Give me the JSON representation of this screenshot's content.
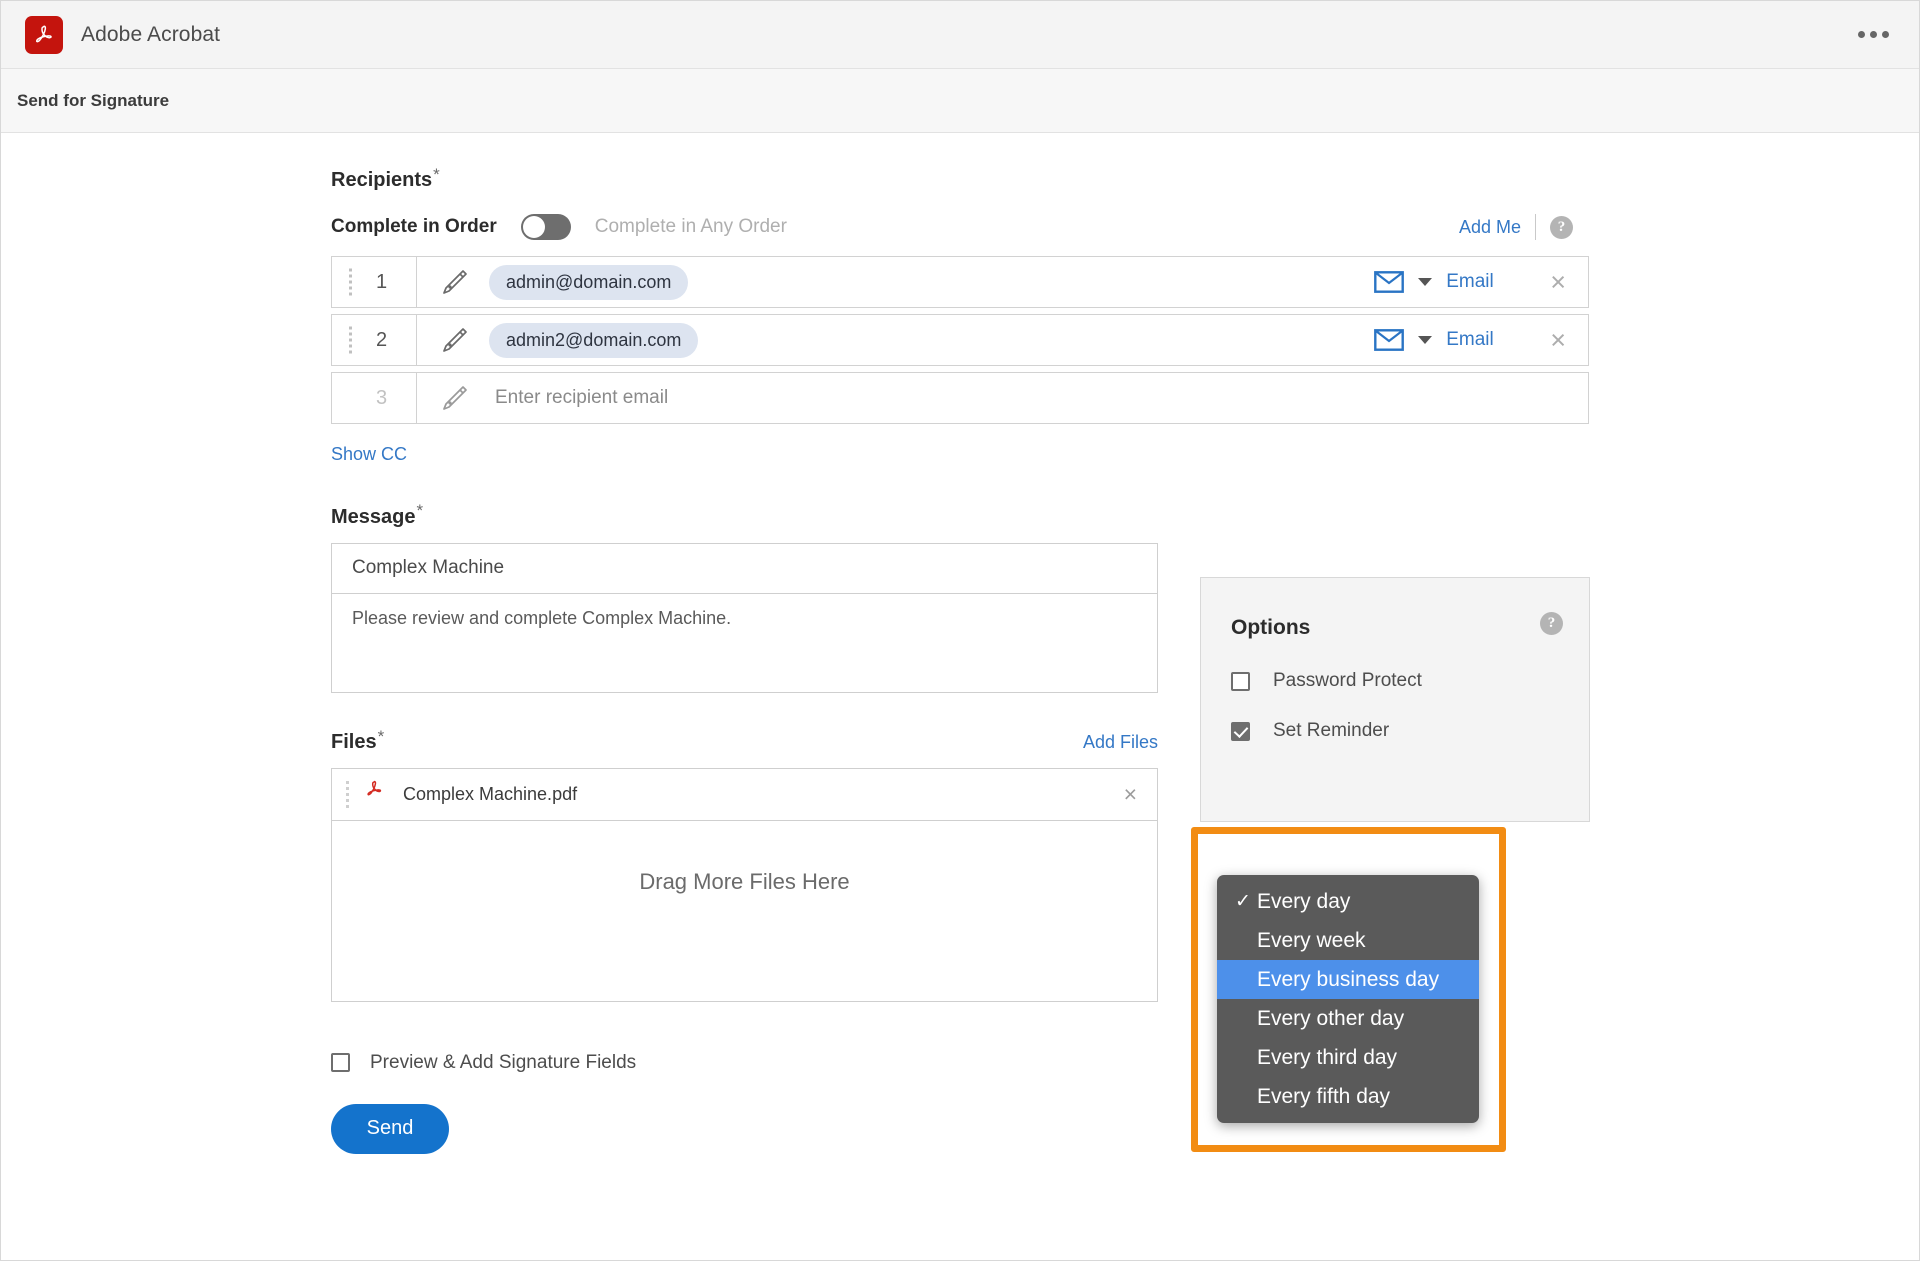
{
  "titlebar": {
    "app_name": "Adobe Acrobat",
    "logo_icon": "acrobat-logo-icon",
    "overflow_icon": "kebab-menu-icon"
  },
  "subheader": {
    "title": "Send for Signature"
  },
  "recipients": {
    "label": "Recipients",
    "required_mark": "*",
    "order_toggle": {
      "on_label": "Complete in Order",
      "off_label": "Complete in Any Order",
      "state": "off"
    },
    "add_me_label": "Add Me",
    "help_icon_glyph": "?",
    "rows": [
      {
        "number": "1",
        "email": "admin@domain.com",
        "delivery_icon": "envelope-icon",
        "delivery_label": "Email",
        "remove_label": "×",
        "is_placeholder": false
      },
      {
        "number": "2",
        "email": "admin2@domain.com",
        "delivery_icon": "envelope-icon",
        "delivery_label": "Email",
        "remove_label": "×",
        "is_placeholder": false
      },
      {
        "number": "3",
        "placeholder": "Enter recipient email",
        "is_placeholder": true
      }
    ],
    "show_cc_label": "Show CC"
  },
  "message": {
    "label": "Message",
    "required_mark": "*",
    "subject_value": "Complex Machine",
    "body_value": "Please review and complete Complex Machine."
  },
  "files": {
    "label": "Files",
    "required_mark": "*",
    "add_files_label": "Add Files",
    "items": [
      {
        "name": "Complex Machine.pdf",
        "icon": "pdf-file-icon",
        "remove_label": "×"
      }
    ],
    "dropzone_label": "Drag More Files Here"
  },
  "footer": {
    "preview_checkbox_label": "Preview & Add Signature Fields",
    "preview_checked": false,
    "send_label": "Send"
  },
  "options": {
    "title": "Options",
    "help_icon_glyph": "?",
    "items": [
      {
        "label": "Password Protect",
        "checked": false
      },
      {
        "label": "Set Reminder",
        "checked": true
      }
    ]
  },
  "reminder_dropdown": {
    "selected": "Every day",
    "highlighted": "Every business day",
    "check_glyph": "✓",
    "items": [
      {
        "label": "Every day",
        "checked": true,
        "highlighted": false
      },
      {
        "label": "Every week",
        "checked": false,
        "highlighted": false
      },
      {
        "label": "Every business day",
        "checked": false,
        "highlighted": true
      },
      {
        "label": "Every other day",
        "checked": false,
        "highlighted": false
      },
      {
        "label": "Every third day",
        "checked": false,
        "highlighted": false
      },
      {
        "label": "Every fifth day",
        "checked": false,
        "highlighted": false
      }
    ]
  },
  "colors": {
    "accent_blue": "#3478c6",
    "send_button": "#1473cc",
    "highlight_orange": "#f28c13",
    "dropdown_bg": "#5a5a5a",
    "dropdown_selected": "#4d90ea",
    "acrobat_red": "#c4140d"
  }
}
